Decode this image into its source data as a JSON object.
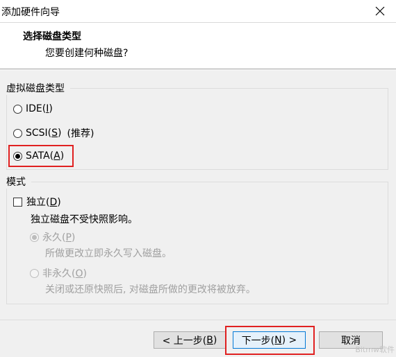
{
  "window": {
    "title": "添加硬件向导"
  },
  "header": {
    "title": "选择磁盘类型",
    "subtitle": "您要创建何种磁盘?"
  },
  "disk_type": {
    "label": "虚拟磁盘类型",
    "options": [
      {
        "text": "IDE(",
        "key": "I",
        "after": ")",
        "extra": "",
        "checked": false
      },
      {
        "text": "SCSI(",
        "key": "S",
        "after": ")",
        "extra": "(推荐)",
        "checked": false
      },
      {
        "text": "SATA(",
        "key": "A",
        "after": ")",
        "extra": "",
        "checked": true
      }
    ]
  },
  "mode": {
    "label": "模式",
    "independent": {
      "text": "独立(",
      "key": "D",
      "after": ")",
      "checked": false
    },
    "independent_desc": "独立磁盘不受快照影响。",
    "persistent": {
      "text": "永久(",
      "key": "P",
      "after": ")",
      "desc": "所做更改立即永久写入磁盘。",
      "checked": true
    },
    "nonpersistent": {
      "text": "非永久(",
      "key": "O",
      "after": ")",
      "desc": "关闭或还原快照后, 对磁盘所做的更改将被放弃。",
      "checked": false
    }
  },
  "footer": {
    "back": {
      "text": "< 上一步(",
      "key": "B",
      "after": ")"
    },
    "next": {
      "text": "下一步(",
      "key": "N",
      "after": ") >"
    },
    "cancel": "取消"
  },
  "watermark": "Bitmw软件"
}
